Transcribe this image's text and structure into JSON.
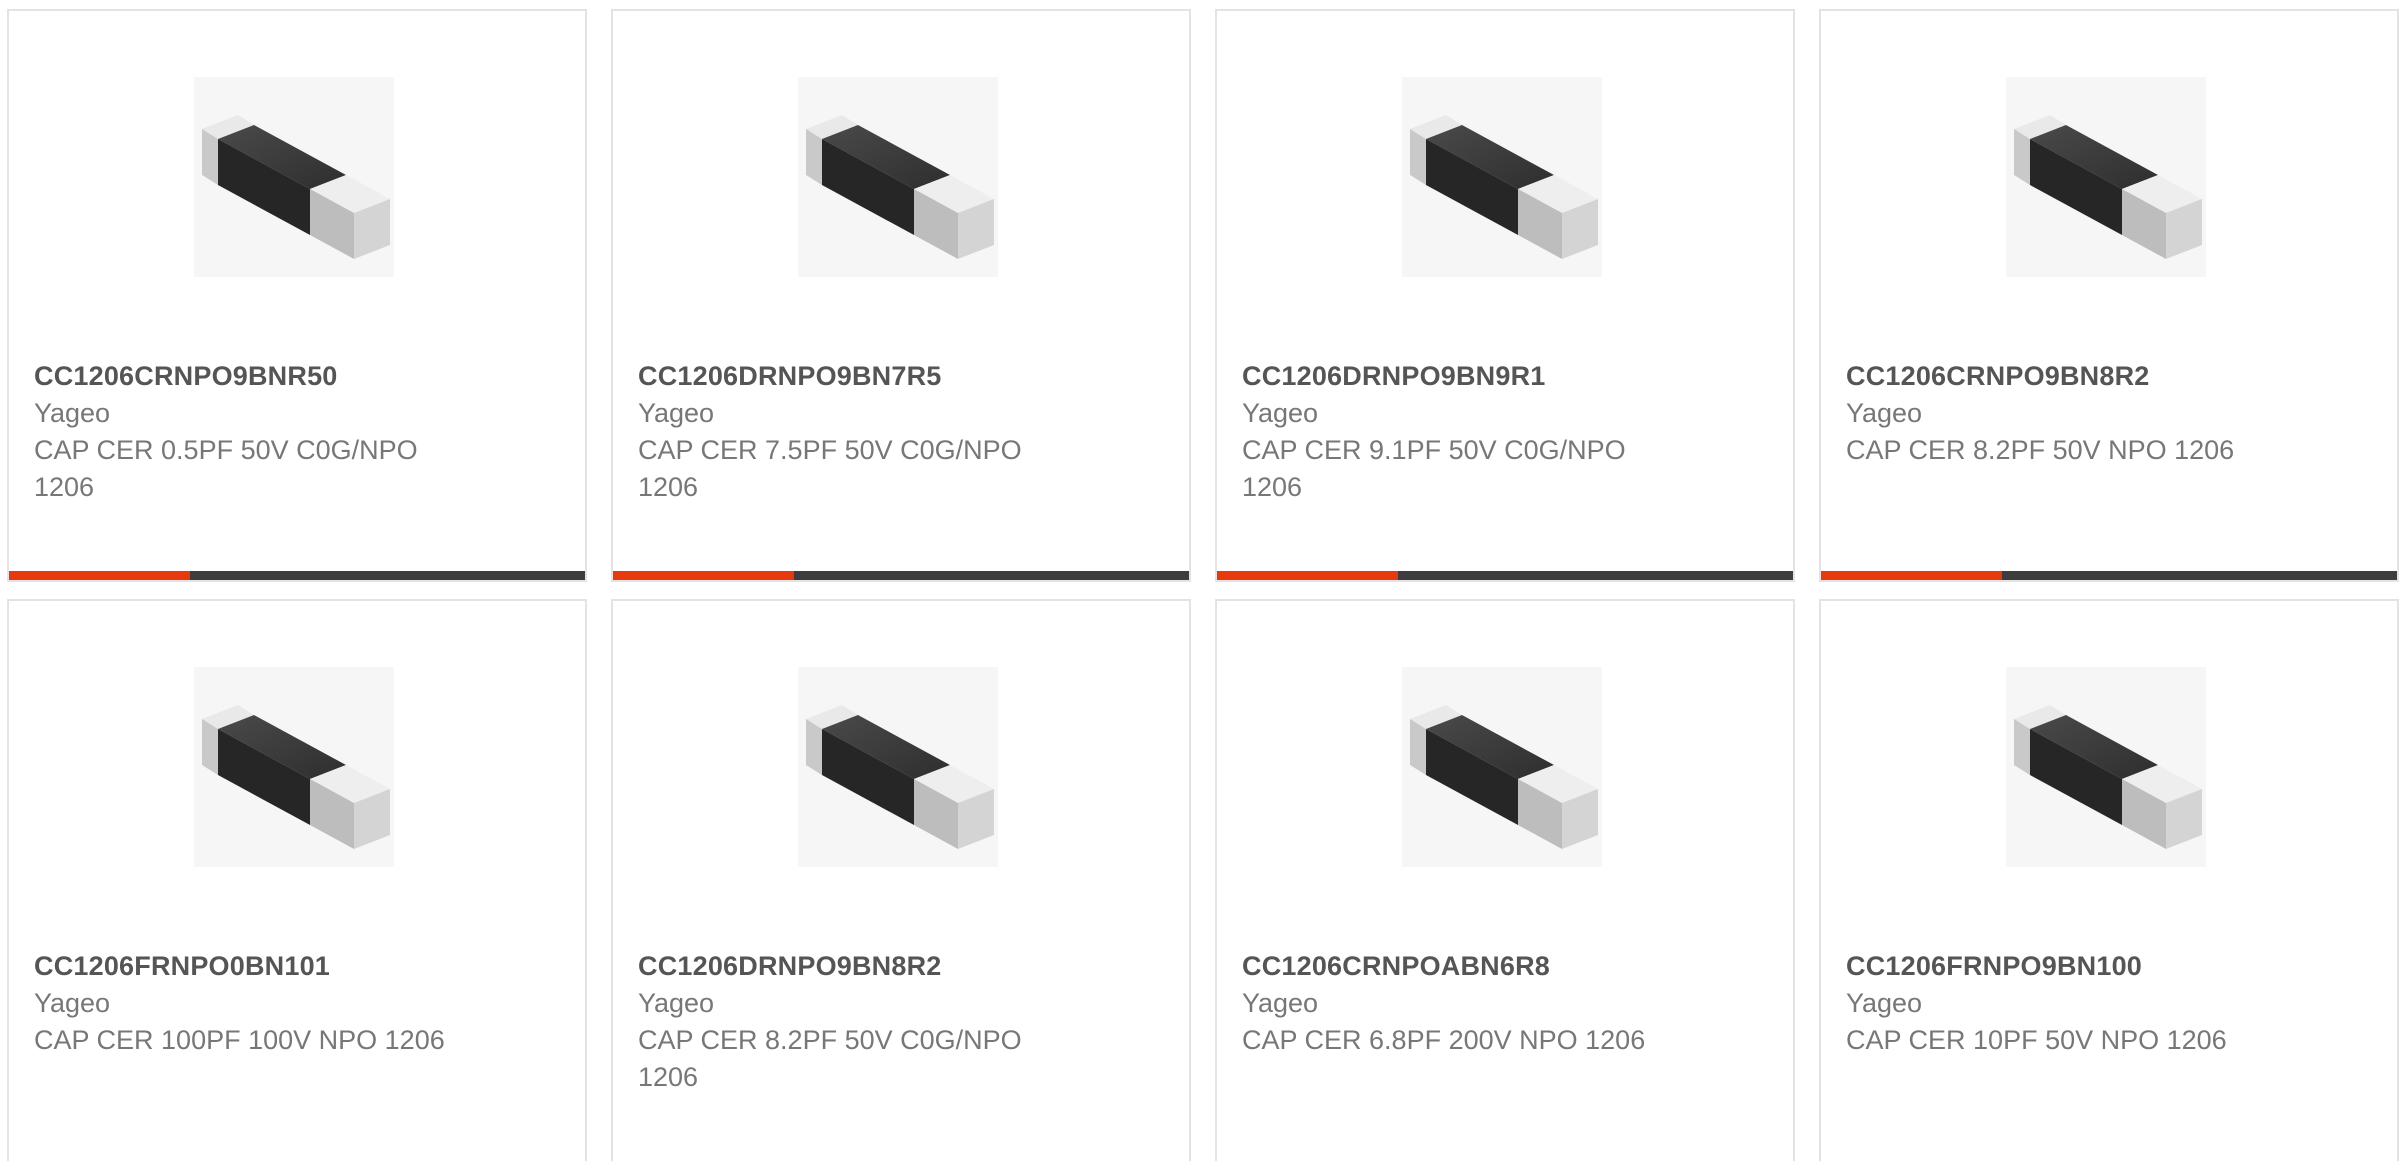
{
  "accent_color": "#e8380d",
  "track_color": "#3d3d3d",
  "products": [
    {
      "part": "CC1206CRNPO9BNR50",
      "maker": "Yageo",
      "desc": "CAP CER 0.5PF 50V C0G/NPO 1206",
      "icon": "chip-capacitor-image",
      "progress": 0.315
    },
    {
      "part": "CC1206DRNPO9BN7R5",
      "maker": "Yageo",
      "desc": "CAP CER 7.5PF 50V C0G/NPO 1206",
      "icon": "chip-capacitor-image",
      "progress": 0.315
    },
    {
      "part": "CC1206DRNPO9BN9R1",
      "maker": "Yageo",
      "desc": "CAP CER 9.1PF 50V C0G/NPO 1206",
      "icon": "chip-capacitor-image",
      "progress": 0.315
    },
    {
      "part": "CC1206CRNPO9BN8R2",
      "maker": "Yageo",
      "desc": "CAP CER 8.2PF 50V NPO 1206",
      "icon": "chip-capacitor-image",
      "progress": 0.315
    },
    {
      "part": "CC1206FRNPO0BN101",
      "maker": "Yageo",
      "desc": "CAP CER 100PF 100V NPO 1206",
      "icon": "chip-capacitor-image"
    },
    {
      "part": "CC1206DRNPO9BN8R2",
      "maker": "Yageo",
      "desc": "CAP CER 8.2PF 50V C0G/NPO 1206",
      "icon": "chip-capacitor-image"
    },
    {
      "part": "CC1206CRNPOABN6R8",
      "maker": "Yageo",
      "desc": "CAP CER 6.8PF 200V NPO 1206",
      "icon": "chip-capacitor-image"
    },
    {
      "part": "CC1206FRNPO9BN100",
      "maker": "Yageo",
      "desc": "CAP CER 10PF 50V NPO 1206",
      "icon": "chip-capacitor-image"
    }
  ]
}
